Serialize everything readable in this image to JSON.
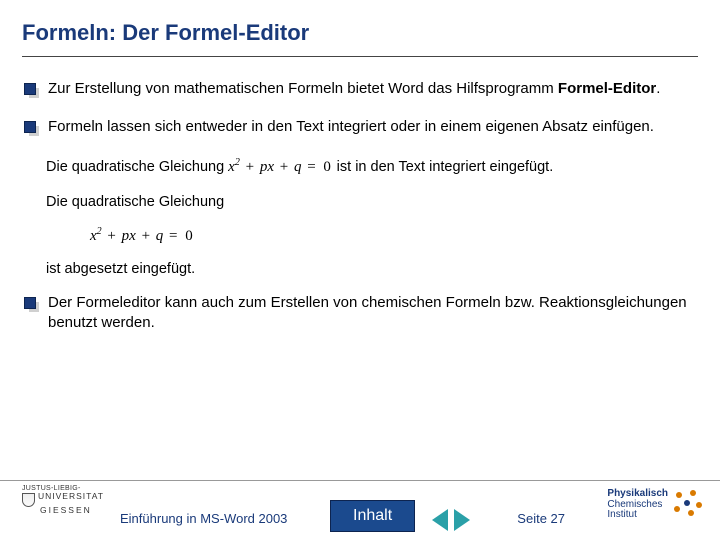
{
  "title": "Formeln: Der Formel-Editor",
  "bullets": {
    "b1_a": "Zur Erstellung von mathematischen Formeln bietet Word das Hilfsprogramm ",
    "b1_b": "Formel-Editor",
    "b1_c": ".",
    "b2": "Formeln lassen sich entweder in den Text integriert oder in einem eigenen Absatz einfügen.",
    "b3": "Der Formeleditor kann auch zum Erstellen von chemischen Formeln bzw. Reaktionsgleichungen benutzt werden."
  },
  "sub": {
    "inline_a": "Die quadratische Gleichung ",
    "inline_b": " ist in den Text integriert eingefügt.",
    "block_intro": "Die quadratische Gleichung",
    "block_outro": "ist abgesetzt eingefügt."
  },
  "formula": {
    "x": "x",
    "sq": "2",
    "plus": "+",
    "p": "p",
    "q": "q",
    "eq": "=",
    "zero": "0"
  },
  "footer": {
    "left_univ1": "JUSTUS-LIEBIG-",
    "left_univ2": "UNIVERSITAT",
    "left_univ3": "GIESSEN",
    "course": "Einführung in MS-Word 2003",
    "inhalt": "Inhalt",
    "page_label": "Seite 27",
    "right1": "Physikalisch",
    "right2": "Chemisches",
    "right3": "Institut"
  }
}
